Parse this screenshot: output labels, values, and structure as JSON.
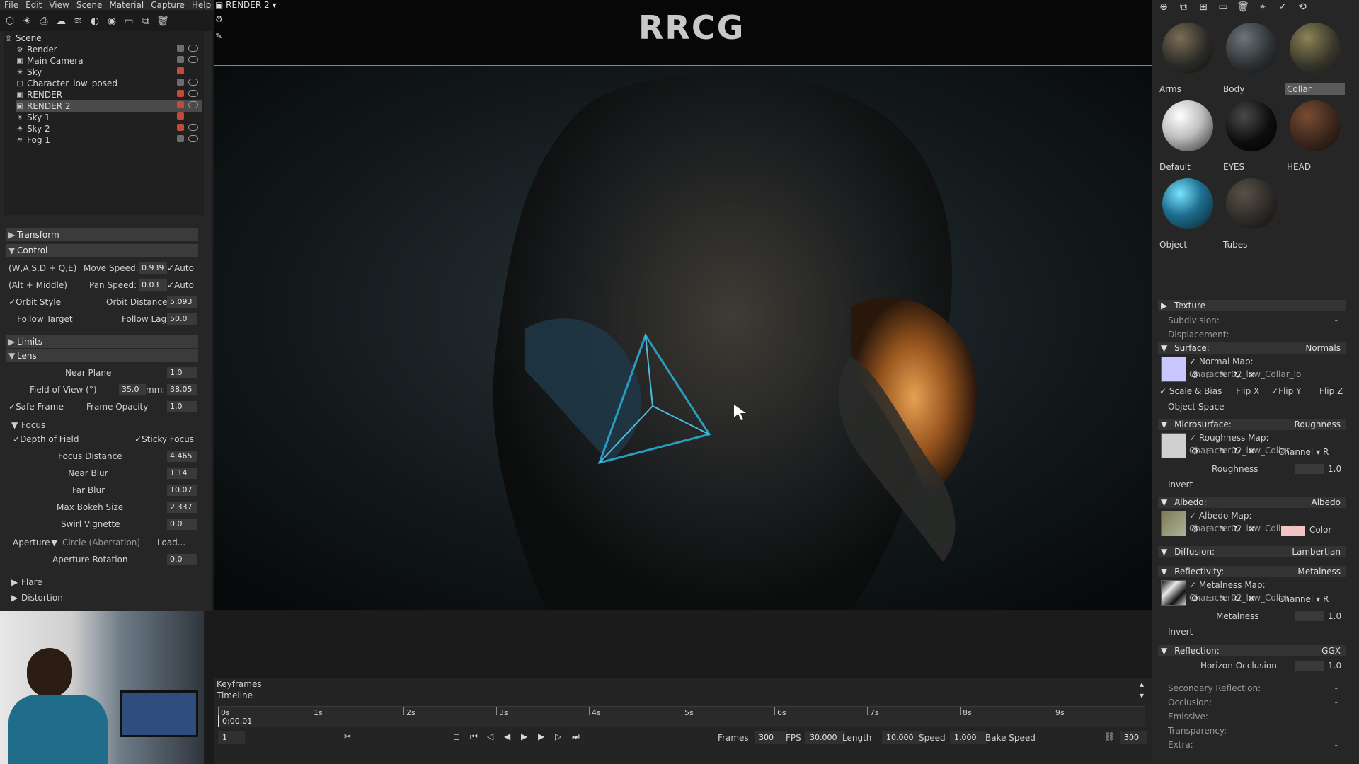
{
  "menu": [
    "File",
    "Edit",
    "View",
    "Scene",
    "Material",
    "Capture",
    "Help"
  ],
  "scene_tree": {
    "items": [
      {
        "label": "Scene",
        "icon": "scene-icon",
        "selected": false
      },
      {
        "label": "Render",
        "icon": "gear-icon",
        "selected": false
      },
      {
        "label": "Main Camera",
        "icon": "camera-icon",
        "selected": false
      },
      {
        "label": "Sky",
        "icon": "sky-icon",
        "selected": false
      },
      {
        "label": "Character_low_posed",
        "icon": "mesh-icon",
        "selected": false
      },
      {
        "label": "RENDER",
        "icon": "camera-icon",
        "selected": false
      },
      {
        "label": "RENDER 2",
        "icon": "camera-icon",
        "selected": true
      },
      {
        "label": "Sky 1",
        "icon": "sky-icon",
        "selected": false
      },
      {
        "label": "Sky 2",
        "icon": "sky-icon",
        "selected": false
      },
      {
        "label": "Fog 1",
        "icon": "fog-icon",
        "selected": false
      }
    ]
  },
  "left_panel": {
    "transform": "Transform",
    "control": "Control",
    "keys_label": "(W,A,S,D + Q,E)",
    "move_speed_label": "Move Speed:",
    "move_speed": "0.939",
    "auto1": "Auto",
    "alt_label": "(Alt + Middle)",
    "pan_speed_label": "Pan Speed:",
    "pan_speed": "0.03",
    "auto2": "Auto",
    "orbit_style": "Orbit Style",
    "orbit_distance_label": "Orbit Distance:",
    "orbit_distance": "5.093",
    "follow_target": "Follow Target",
    "follow_lag_label": "Follow Lag",
    "follow_lag": "50.0",
    "limits": "Limits",
    "lens": "Lens",
    "near_plane_label": "Near Plane",
    "near_plane": "1.0",
    "fov_label": "Field of View (°)",
    "fov": "35.0",
    "mm_label": "mm:",
    "mm": "38.05",
    "safe_frame": "Safe Frame",
    "frame_opacity_label": "Frame Opacity",
    "frame_opacity": "1.0",
    "focus": "Focus",
    "depth_of_field": "Depth of Field",
    "sticky_focus": "Sticky Focus",
    "focus_distance_label": "Focus Distance",
    "focus_distance": "4.465",
    "near_blur_label": "Near Blur",
    "near_blur": "1.14",
    "far_blur_label": "Far Blur",
    "far_blur": "10.07",
    "max_bokeh_label": "Max Bokeh Size",
    "max_bokeh": "2.337",
    "swirl_vignette_label": "Swirl Vignette",
    "swirl_vignette": "0.0",
    "aperture_label": "Aperture",
    "aperture_value": "Circle (Aberration)",
    "load_label": "Load...",
    "aperture_rotation_label": "Aperture Rotation",
    "aperture_rotation": "0.0",
    "flare": "Flare",
    "distortion": "Distortion"
  },
  "viewport": {
    "tab_label": "RENDER 2",
    "watermark": "RRCG"
  },
  "timeline": {
    "keyframes_label": "Keyframes",
    "timeline_label": "Timeline",
    "current_time": "0:00.01",
    "ticks": [
      "0s",
      "1s",
      "2s",
      "3s",
      "4s",
      "5s",
      "6s",
      "7s",
      "8s",
      "9s"
    ],
    "frame_field": "1",
    "frames_label": "Frames",
    "frames": "300",
    "fps_label": "FPS",
    "fps": "30.000",
    "length_label": "Length",
    "length": "10.000",
    "speed_label": "Speed",
    "speed": "1.000",
    "bake_speed": "Bake Speed",
    "end_frame": "300"
  },
  "materials": {
    "items": [
      {
        "name": "Arms",
        "selected": false,
        "ball_color": "#2c2b27"
      },
      {
        "name": "Body",
        "selected": false,
        "ball_color": "#2f3336"
      },
      {
        "name": "Collar",
        "selected": true,
        "ball_color": "#3a382c"
      },
      {
        "name": "Default",
        "selected": false,
        "ball_color": "#bfbfbf"
      },
      {
        "name": "EYES",
        "selected": false,
        "ball_color": "#0d0d0d"
      },
      {
        "name": "HEAD",
        "selected": false,
        "ball_color": "#3b261c"
      },
      {
        "name": "Object",
        "selected": false,
        "ball_color": "#1d6f8f"
      },
      {
        "name": "Tubes",
        "selected": false,
        "ball_color": "#2d2a27"
      }
    ]
  },
  "material_props": {
    "texture": "Texture",
    "subdivision": "Subdivision:",
    "displacement": "Displacement:",
    "surface": "Surface:",
    "surface_mode": "Normals",
    "normal_map": "Normal Map:",
    "normal_map_file": "Character02_low_Collar_lo",
    "scale_bias": "Scale & Bias",
    "flip_x": "Flip X",
    "flip_y": "Flip Y",
    "flip_z": "Flip Z",
    "object_space": "Object Space",
    "microsurface": "Microsurface:",
    "microsurface_mode": "Roughness",
    "roughness_map": "Roughness Map:",
    "roughness_map_file": "Character02_low_Collar",
    "channel_label": "Channel",
    "channel_r": "R",
    "roughness_label": "Roughness",
    "roughness_value": "1.0",
    "invert": "Invert",
    "albedo": "Albedo:",
    "albedo_mode": "Albedo",
    "albedo_map": "Albedo Map:",
    "albedo_map_file": "Character02_low_Collar_lo",
    "color_label": "Color",
    "diffusion": "Diffusion:",
    "diffusion_mode": "Lambertian",
    "reflectivity": "Reflectivity:",
    "reflectivity_mode": "Metalness",
    "metalness_map": "Metalness Map:",
    "metalness_map_file": "Character02_low_Collar",
    "metalness_label": "Metalness",
    "metalness_value": "1.0",
    "reflection": "Reflection:",
    "reflection_mode": "GGX",
    "horizon_occlusion_label": "Horizon Occlusion",
    "horizon_occlusion_value": "1.0",
    "secondary_reflection": "Secondary Reflection:",
    "occlusion": "Occlusion:",
    "emissive": "Emissive:",
    "transparency": "Transparency:",
    "extra": "Extra:",
    "dash": "-"
  },
  "colors": {
    "accent_blue": "#2aa3c8",
    "selected_row": "#4a4a4a",
    "lock_red": "#c24a3a"
  }
}
